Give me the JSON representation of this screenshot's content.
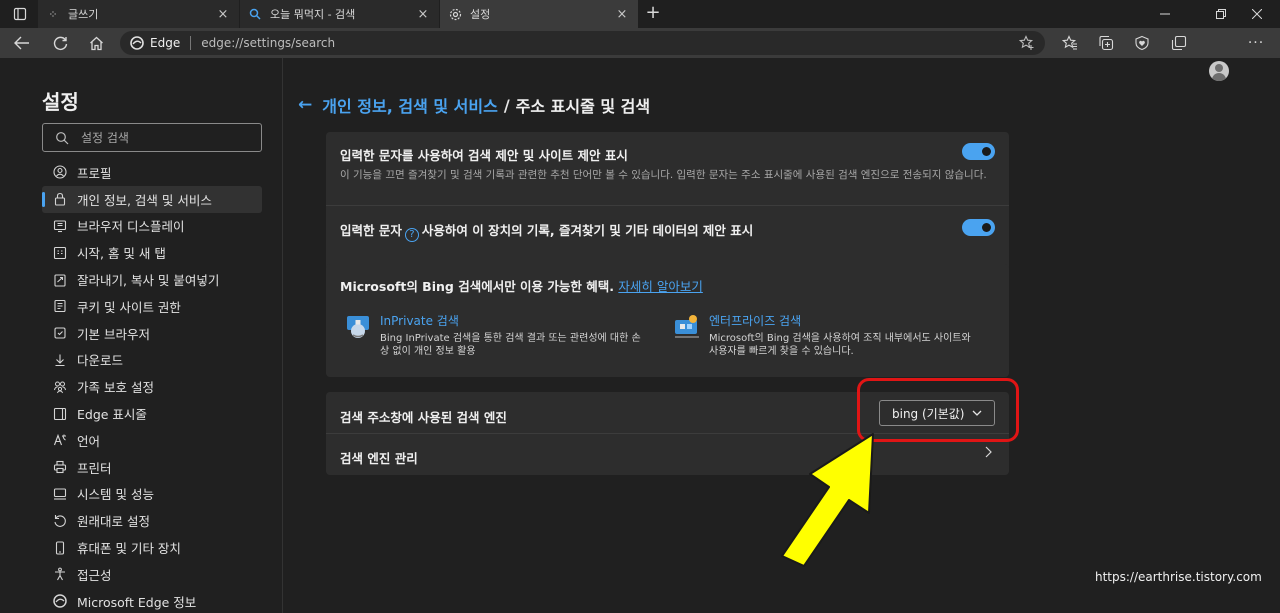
{
  "tabs": [
    {
      "title": "글쓰기",
      "favicon": "tistory-dots-icon",
      "active": false
    },
    {
      "title": "오늘 뭐먹지 - 검색",
      "favicon": "search-icon",
      "active": false
    },
    {
      "title": "설정",
      "favicon": "gear-icon",
      "active": true
    }
  ],
  "address_bar": {
    "brand": "Edge",
    "url": "edge://settings/search"
  },
  "sidebar": {
    "title": "설정",
    "search_placeholder": "설정 검색",
    "items": [
      {
        "label": "프로필",
        "icon": "profile-icon"
      },
      {
        "label": "개인 정보, 검색 및 서비스",
        "icon": "lock-icon",
        "active": true
      },
      {
        "label": "브라우저 디스플레이",
        "icon": "display-icon"
      },
      {
        "label": "시작, 홈 및 새 탭",
        "icon": "power-icon"
      },
      {
        "label": "잘라내기, 복사 및 붙여넣기",
        "icon": "clipboard-icon"
      },
      {
        "label": "쿠키 및 사이트 권한",
        "icon": "cookie-icon"
      },
      {
        "label": "기본 브라우저",
        "icon": "browser-icon"
      },
      {
        "label": "다운로드",
        "icon": "download-icon"
      },
      {
        "label": "가족 보호 설정",
        "icon": "family-icon"
      },
      {
        "label": "Edge 표시줄",
        "icon": "edge-bar-icon"
      },
      {
        "label": "언어",
        "icon": "language-icon"
      },
      {
        "label": "프린터",
        "icon": "printer-icon"
      },
      {
        "label": "시스템 및 성능",
        "icon": "system-icon"
      },
      {
        "label": "원래대로 설정",
        "icon": "reset-icon"
      },
      {
        "label": "휴대폰 및 기타 장치",
        "icon": "phone-icon"
      },
      {
        "label": "접근성",
        "icon": "accessibility-icon"
      },
      {
        "label": "Microsoft Edge 정보",
        "icon": "edge-logo-icon"
      }
    ]
  },
  "breadcrumb": {
    "parent": "개인 정보, 검색 및 서비스",
    "separator": "/",
    "current": "주소 표시줄 및 검색"
  },
  "suggestions": {
    "row1_title": "입력한 문자를 사용하여 검색 제안 및 사이트 제안 표시",
    "row1_desc": "이 기능을 끄면 즐겨찾기 및 검색 기록과 관련한 추천 단어만 볼 수 있습니다. 입력한 문자는 주소 표시줄에 사용된 검색 엔진으로 전송되지 않습니다.",
    "row1_on": true,
    "row2_title_a": "입력한 문자",
    "row2_title_b": "사용하여 이 장치의 기록, 즐겨찾기 및 기타 데이터의 제안 표시",
    "row2_on": true
  },
  "bing": {
    "title": "Microsoft의 Bing 검색에서만 이용 가능한 혜택.",
    "link": "자세히 알아보기",
    "feature1_name": "InPrivate 검색",
    "feature1_desc": "Bing InPrivate 검색을 통한 검색 결과 또는 관련성에 대한 손상 없이 개인 정보 활용",
    "feature2_name": "엔터프라이즈 검색",
    "feature2_desc": "Microsoft의 Bing 검색을 사용하여 조직 내부에서도 사이트와 사용자를 빠르게 찾을 수 있습니다."
  },
  "engine": {
    "label": "검색 주소창에 사용된 검색 엔진",
    "selected": "bing (기본값)",
    "manage_label": "검색 엔진 관리"
  },
  "annotation": {
    "highlight_color": "#e01515",
    "arrow_color": "#ffff00"
  },
  "watermark": "https://earthrise.tistory.com",
  "colors": {
    "accent": "#4aa3f0",
    "background": "#202020",
    "card": "#2d2d2d"
  }
}
